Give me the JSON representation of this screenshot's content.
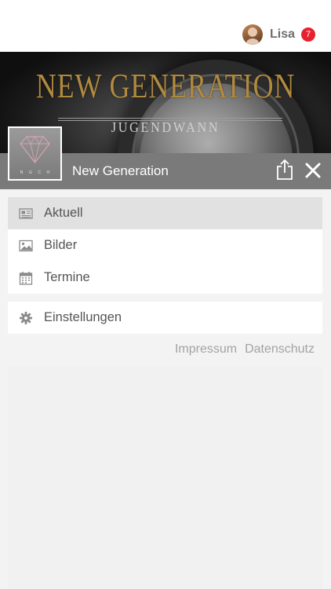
{
  "user": {
    "name": "Lisa",
    "badge_count": "7"
  },
  "hero": {
    "brand": "NEW GENERATION",
    "subtitle": "JUGENDWANN"
  },
  "page": {
    "title": "New Generation"
  },
  "logo": {
    "letters": [
      "N",
      "G",
      "C",
      "H"
    ]
  },
  "menu": {
    "items": [
      {
        "label": "Aktuell",
        "icon": "newspaper-icon",
        "active": true
      },
      {
        "label": "Bilder",
        "icon": "image-icon",
        "active": false
      },
      {
        "label": "Termine",
        "icon": "calendar-icon",
        "active": false
      }
    ],
    "settings": {
      "label": "Einstellungen",
      "icon": "gear-icon"
    }
  },
  "footer": {
    "impressum": "Impressum",
    "datenschutz": "Datenschutz"
  },
  "colors": {
    "badge": "#e8212e",
    "titlebar": "#7a7a7a",
    "active_item": "#e1e1e1",
    "brand_gold": "#b08a3e"
  }
}
